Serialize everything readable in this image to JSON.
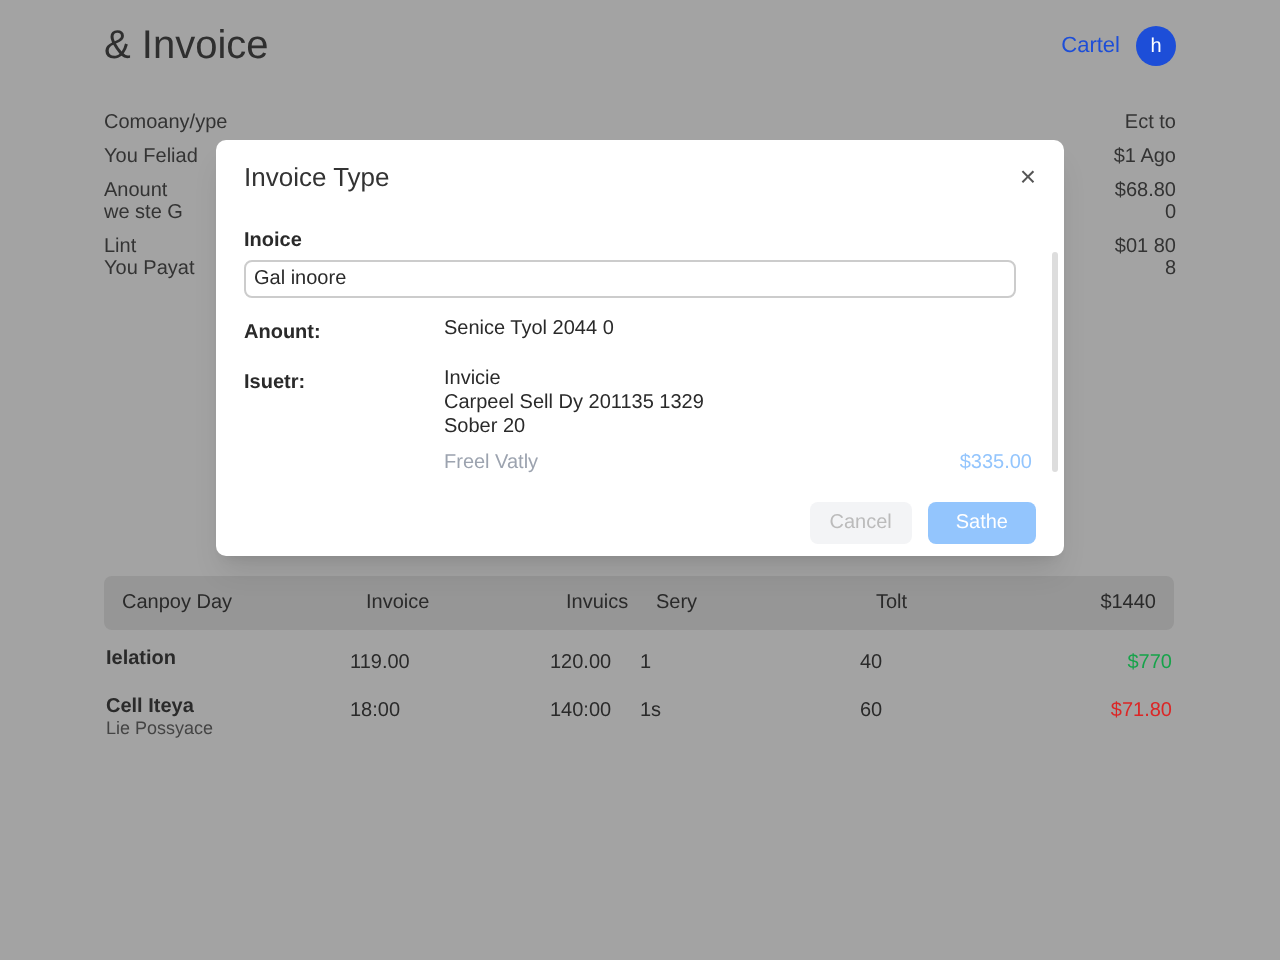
{
  "header": {
    "title": "& Invoice",
    "link": "Cartel",
    "avatar": "h"
  },
  "summary": [
    {
      "label": "Comoany/ype",
      "value": "Ect to"
    },
    {
      "label": "You Feliad",
      "value": "$1 Ago"
    },
    {
      "label": "Anount",
      "sub": "we ste G",
      "value": "$68.80",
      "value_sub": "0"
    },
    {
      "label": "Lint",
      "sub": "You Payat",
      "value": "$01 80",
      "value_sub": "8"
    }
  ],
  "dialog": {
    "title": "Invoice Type",
    "close": "×",
    "field_label": "Inoice",
    "field_value": "Gal inoore",
    "rows": [
      {
        "label": "Anount:",
        "lines": [
          "Senice Tyol 2044 0"
        ]
      },
      {
        "label": "Isuetr:",
        "lines": [
          "Invicie",
          "Carpeel Sell Dy 201135 1329",
          "Sober 20"
        ]
      }
    ],
    "extra": {
      "label": "Freel Vatly",
      "value": "$335.00"
    },
    "buttons": [
      {
        "label": "Cancel",
        "kind": "secondary"
      },
      {
        "label": "Sathe",
        "kind": "primary"
      }
    ]
  },
  "table": {
    "columns": [
      "Canpoy Day",
      "Invoice",
      "Invuics",
      "Sery",
      "Tolt",
      "$1440"
    ],
    "rows": [
      {
        "cells": [
          "Ielation",
          "119.00",
          "120.00",
          "1",
          "40",
          "$770"
        ],
        "color": "#16a34a"
      },
      {
        "cells": [
          "Cell Iteya",
          "18:00",
          "140:00",
          "1s",
          "60",
          "$71.80"
        ],
        "sub": "Lie Possyace",
        "color": "#dc2626"
      }
    ]
  }
}
